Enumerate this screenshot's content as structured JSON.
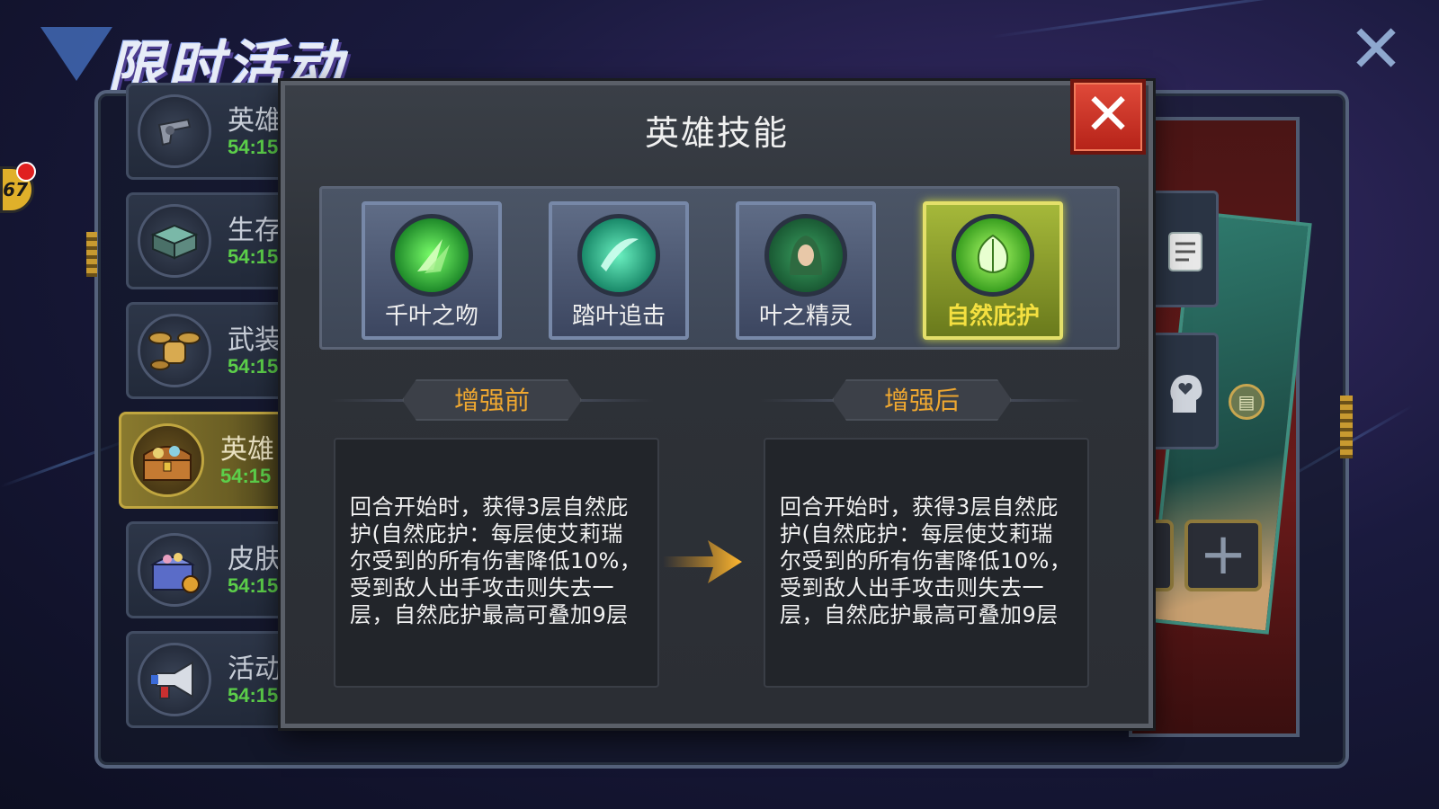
{
  "banner": {
    "title": "限时活动"
  },
  "close_glyph": "✕",
  "event_list": {
    "badge": "67",
    "items": [
      {
        "name": "英雄",
        "time": "54:15",
        "icon": "revolver-icon"
      },
      {
        "name": "生存",
        "time": "54:15",
        "icon": "crate-icon"
      },
      {
        "name": "武装",
        "time": "54:15",
        "icon": "drone-icon"
      },
      {
        "name": "英雄",
        "time": "54:15",
        "icon": "treasure-chest-icon"
      },
      {
        "name": "皮肤",
        "time": "54:15",
        "icon": "gift-chest-icon"
      },
      {
        "name": "活动",
        "time": "54:15",
        "icon": "megaphone-icon"
      }
    ],
    "active_index": 3
  },
  "modal": {
    "title": "英雄技能",
    "close_glyph": "✕",
    "skills": [
      {
        "label": "千叶之吻",
        "icon": "leaf-blades-icon",
        "selected": false
      },
      {
        "label": "踏叶追击",
        "icon": "leaf-slash-icon",
        "selected": false
      },
      {
        "label": "叶之精灵",
        "icon": "elf-portrait-icon",
        "selected": false
      },
      {
        "label": "自然庇护",
        "icon": "nature-leaf-icon",
        "selected": true
      }
    ],
    "before": {
      "header": "增强前",
      "text": "回合开始时，获得3层自然庇护(自然庇护：每层使艾莉瑞尔受到的所有伤害降低10%，受到敌人出手攻击则失去一层，自然庇护最高可叠加9层"
    },
    "after": {
      "header": "增强后",
      "text": "回合开始时，获得3层自然庇护(自然庇护：每层使艾莉瑞尔受到的所有伤害降低10%，受到敌人出手攻击则失去一层，自然庇护最高可叠加9层"
    }
  },
  "colors": {
    "accent_orange": "#f0a830",
    "selected_yellow": "#f4e040",
    "close_red": "#d83a2a",
    "timer_green": "#5ccf4a"
  }
}
